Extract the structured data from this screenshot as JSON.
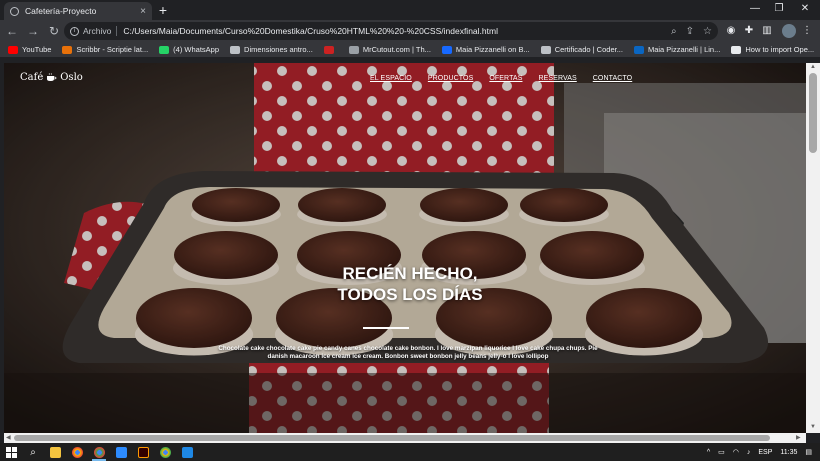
{
  "browser": {
    "tab_title": "Cafetería-Proyecto",
    "tab_close": "×",
    "new_tab": "+",
    "window_controls": {
      "minimize": "—",
      "restore": "❐",
      "close": "✕"
    },
    "nav": {
      "back": "←",
      "forward": "→",
      "reload": "↻"
    },
    "address_chip": "Archivo",
    "url": "C:/Users/Maia/Documents/Curso%20Domestika/Cruso%20HTML%20%20-%20CSS/indexfinal.html",
    "bookmarks": [
      {
        "label": "YouTube",
        "color": "#ff0000"
      },
      {
        "label": "Scribbr - Scriptie lat...",
        "color": "#e8710a"
      },
      {
        "label": "(4) WhatsApp",
        "color": "#25d366"
      },
      {
        "label": "Dimensiones antro...",
        "color": "#bdc1c6"
      },
      {
        "label": "",
        "color": "#cc2222"
      },
      {
        "label": "MrCutout.com | Th...",
        "color": "#9aa0a6"
      },
      {
        "label": "Maia Pizzanelli on B...",
        "color": "#1769ff"
      },
      {
        "label": "Certificado | Coder...",
        "color": "#bdc1c6"
      },
      {
        "label": "Maia Pizzanelli | Lin...",
        "color": "#0a66c2"
      },
      {
        "label": "How to import Ope...",
        "color": "#e8eaed"
      }
    ]
  },
  "page": {
    "logo": {
      "left": "Café",
      "right": "Oslo"
    },
    "nav": [
      "EL ESPACIO",
      "PRODUCTOS",
      "OFERTAS",
      "RESERVAS",
      "CONTACTO"
    ],
    "hero": {
      "line1": "RECIÉN HECHO,",
      "line2": "TODOS LOS DÍAS",
      "text": "Chocolate cake chocolate cake pie candy canes chocolate cake bonbon. I love marzipan liquorice I love cake chupa chups. Pie danish macaroon ice cream ice cream. Bonbon sweet bonbon jelly beans jelly-o I love lollipop"
    }
  },
  "taskbar": {
    "language": "ESP",
    "time": "11:35"
  }
}
